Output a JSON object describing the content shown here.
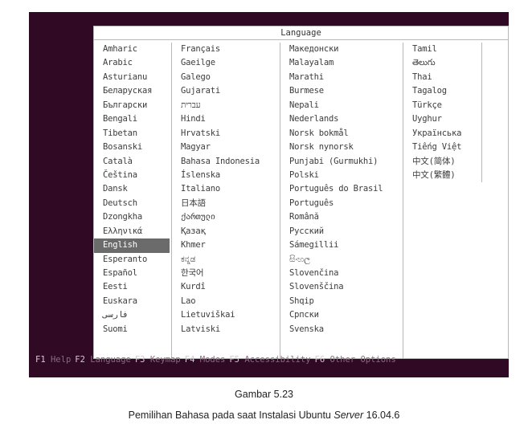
{
  "dialog": {
    "title": "Language",
    "columns": [
      [
        "Amharic",
        "Arabic",
        "Asturianu",
        "Беларуская",
        "Български",
        "Bengali",
        "Tibetan",
        "Bosanski",
        "Català",
        "Čeština",
        "Dansk",
        "Deutsch",
        "Dzongkha",
        "Ελληνικά",
        "English",
        "Esperanto",
        "Español",
        "Eesti",
        "Euskara",
        "فارسی",
        "Suomi"
      ],
      [
        "Français",
        "Gaeilge",
        "Galego",
        "Gujarati",
        "עברית",
        "Hindi",
        "Hrvatski",
        "Magyar",
        "Bahasa Indonesia",
        "Íslenska",
        "Italiano",
        "日本語",
        "ქართული",
        "Қазақ",
        "Khmer",
        "ಕನ್ನಡ",
        "한국어",
        "Kurdî",
        "Lao",
        "Lietuviškai",
        "Latviski"
      ],
      [
        "Македонски",
        "Malayalam",
        "Marathi",
        "Burmese",
        "Nepali",
        "Nederlands",
        "Norsk bokmål",
        "Norsk nynorsk",
        "Punjabi (Gurmukhi)",
        "Polski",
        "Português do Brasil",
        "Português",
        "Română",
        "Русский",
        "Sámegillii",
        "සිංහල",
        "Slovenčina",
        "Slovenščina",
        "Shqip",
        "Српски",
        "Svenska"
      ],
      [
        "Tamil",
        "తెలుగు",
        "Thai",
        "Tagalog",
        "Türkçe",
        "Uyghur",
        "Українська",
        "Tiếng Việt",
        "中文(简体)",
        "中文(繁體)"
      ]
    ],
    "selected": "English"
  },
  "statusbar": [
    {
      "key": "F1",
      "label": "Help"
    },
    {
      "key": "F2",
      "label": "Language"
    },
    {
      "key": "F3",
      "label": "Keymap"
    },
    {
      "key": "F4",
      "label": "Modes"
    },
    {
      "key": "F5",
      "label": "Accessibility"
    },
    {
      "key": "F6",
      "label": "Other Options"
    }
  ],
  "captions": {
    "figure": "Gambar 5.23",
    "description_prefix": "Pemilihan Bahasa pada saat Instalasi Ubuntu ",
    "description_italic": "Server",
    "description_suffix": " 16.04.6"
  },
  "colors": {
    "screen_background": "#300a24",
    "selection": "#6b6b6b",
    "statusbar_key": "#d8c8d2",
    "statusbar_label": "#8a6a80"
  }
}
